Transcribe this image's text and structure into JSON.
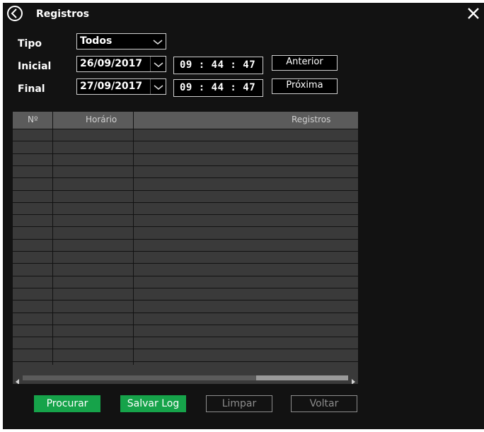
{
  "header": {
    "title": "Registros"
  },
  "form": {
    "tipo_label": "Tipo",
    "tipo_value": "Todos",
    "inicial_label": "Inicial",
    "inicial_date": "26/09/2017",
    "inicial_time": "09 : 44 : 47",
    "final_label": "Final",
    "final_date": "27/09/2017",
    "final_time": "09 : 44 : 47",
    "prev_label": "Anterior",
    "next_label": "Próxima"
  },
  "table": {
    "columns": [
      "Nº",
      "Horário",
      "Registros"
    ],
    "rows": []
  },
  "buttons": {
    "search": "Procurar",
    "save_log": "Salvar Log",
    "clear": "Limpar",
    "back": "Voltar"
  },
  "colors": {
    "background": "#121212",
    "primary": "#16a34a",
    "table": "#3a3a3a",
    "table_header": "#5b5b5b"
  },
  "icons": [
    "back-arrow-circle-icon",
    "close-icon",
    "chevron-down-icon",
    "scroll-left-icon",
    "scroll-right-icon"
  ]
}
